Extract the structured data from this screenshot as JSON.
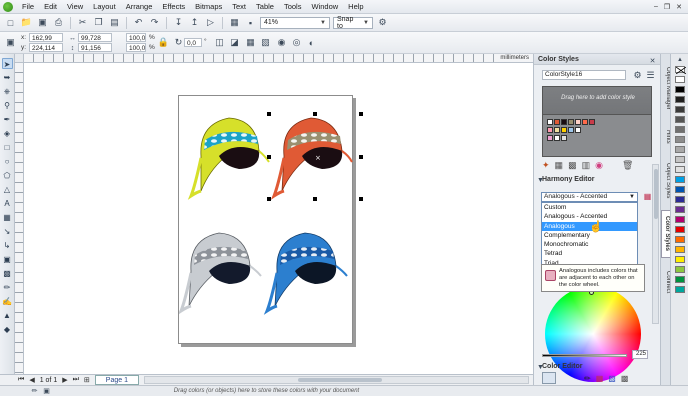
{
  "menu": [
    "File",
    "Edit",
    "View",
    "Layout",
    "Arrange",
    "Effects",
    "Bitmaps",
    "Text",
    "Table",
    "Tools",
    "Window",
    "Help"
  ],
  "toolbar": {
    "zoom": "41%",
    "snap": "Snap to"
  },
  "properties": {
    "x_label": "x:",
    "x_value": "162,99 mm",
    "y_label": "y:",
    "y_value": "224,114 mm",
    "w_value": "99,728 mm",
    "h_value": "91,156 mm",
    "sx": "100,0",
    "sy": "100,0",
    "pct1": "%",
    "pct2": "%",
    "rotation": "0,0",
    "degree": "°"
  },
  "ruler_unit": "millimeters",
  "pagebar": {
    "page_count": "1 of 1",
    "page_tab": "Page 1"
  },
  "status_hint": "Drag colors (or objects) here to store these colors with your document",
  "docker": {
    "title": "Color Styles",
    "style_name": "ColorStyle16",
    "drop_hint": "Drag here to add color style",
    "harmony_title": "Harmony Editor",
    "harmony_selected": "Analogous - Accented",
    "harmony_options": [
      "Custom",
      "Analogous - Accented",
      "Analogous",
      "Complementary",
      "Monochromatic",
      "Tetrad",
      "Triad"
    ],
    "tooltip": "Analogous includes colors that are adjacent to each other on the color wheel.",
    "slider_value": "225",
    "color_editor_title": "Color Editor"
  },
  "side_tabs": [
    "Object Manager",
    "Hints",
    "Object Styles",
    "Color Styles",
    "Connect"
  ],
  "palette_colors": [
    "#ffffff",
    "#000000",
    "#1f1f1f",
    "#3a3a3a",
    "#555555",
    "#707070",
    "#8c8c8c",
    "#a8a8a8",
    "#c4c4c4",
    "#e0e0e0",
    "#00a0e6",
    "#0055b3",
    "#2b2b96",
    "#6a2c91",
    "#b3006e",
    "#e60000",
    "#ff6a00",
    "#ffb400",
    "#ffed00",
    "#8ec63f",
    "#00923f",
    "#00a79d"
  ]
}
